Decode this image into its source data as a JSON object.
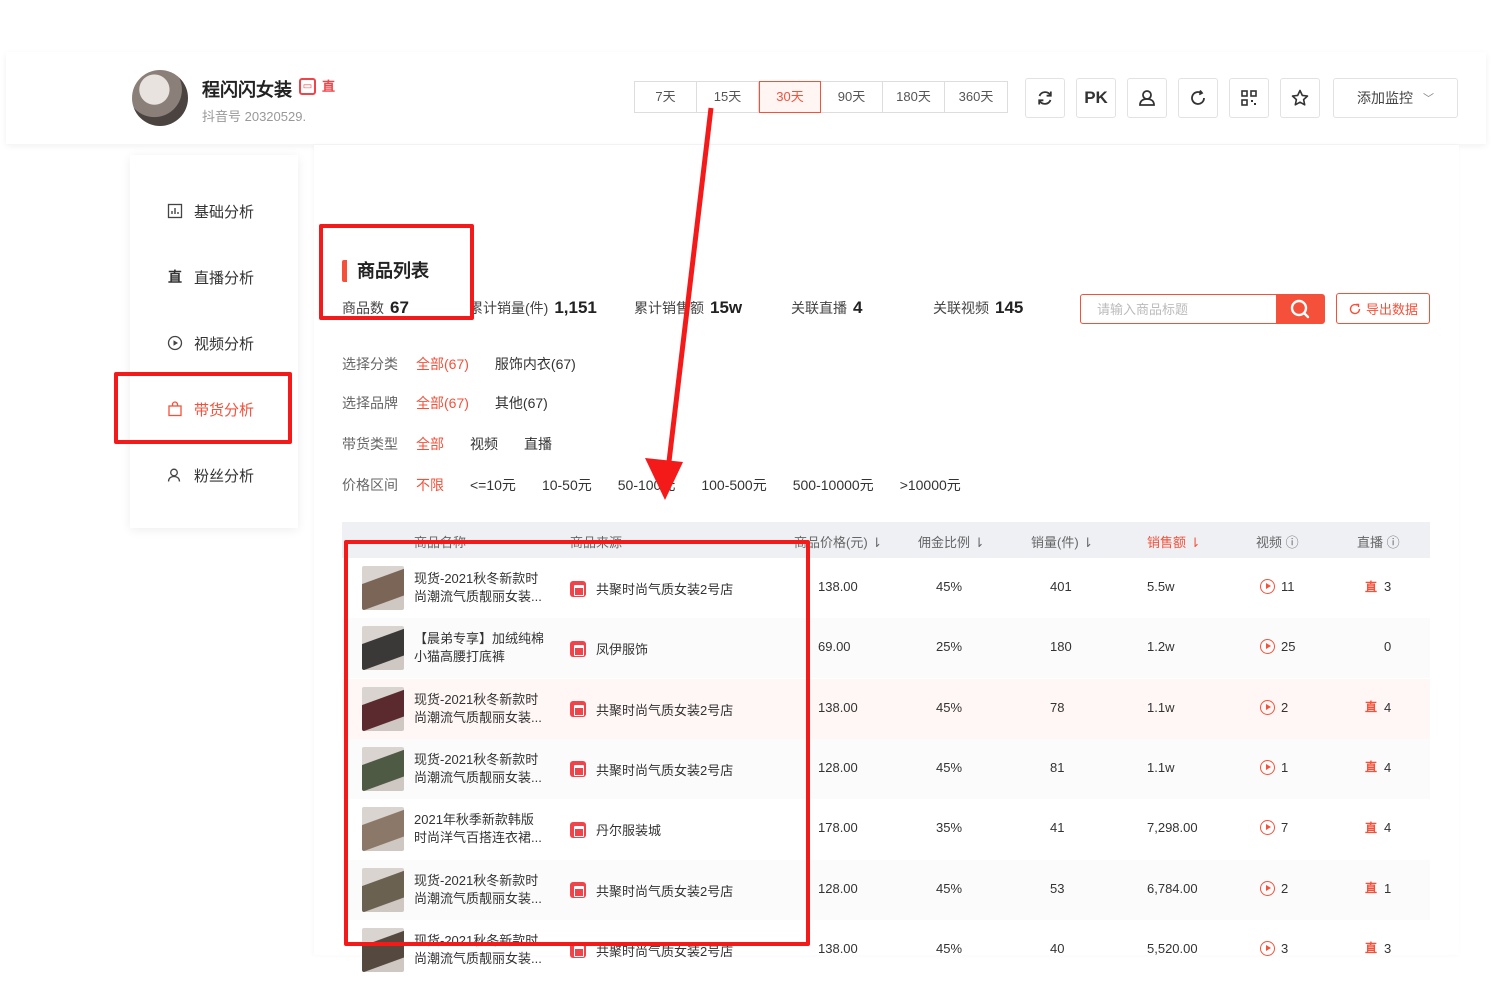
{
  "header": {
    "shop_name": "程闪闪女装",
    "douyin_id": "抖音号 20320529.",
    "badges": [
      "店",
      "直播"
    ],
    "periods": [
      "7天",
      "15天",
      "30天",
      "90天",
      "180天",
      "360天"
    ],
    "active_period": "30天",
    "tools": [
      "refresh-icon",
      "pk",
      "user-icon",
      "reload-icon",
      "qrcode-icon",
      "star-icon"
    ],
    "pk_label": "PK",
    "add_monitor_label": "添加监控"
  },
  "sidebar": {
    "items": [
      {
        "label": "基础分析",
        "icon": "bar-chart-icon"
      },
      {
        "label": "直播分析",
        "icon": "live-icon"
      },
      {
        "label": "视频分析",
        "icon": "play-circle-icon"
      },
      {
        "label": "带货分析",
        "icon": "bag-icon",
        "active": true
      },
      {
        "label": "粉丝分析",
        "icon": "user-icon"
      }
    ]
  },
  "main": {
    "title": "商品列表",
    "stats": [
      {
        "label": "商品数",
        "value": "67"
      },
      {
        "label": "累计销量(件)",
        "value": "1,151"
      },
      {
        "label": "累计销售额",
        "value": "15w"
      },
      {
        "label": "关联直播",
        "value": "4"
      },
      {
        "label": "关联视频",
        "value": "145"
      }
    ],
    "search_placeholder": "请输入商品标题",
    "export_label": "导出数据",
    "filters": [
      {
        "label": "选择分类",
        "options": [
          "全部(67)",
          "服饰内衣(67)"
        ],
        "active": 0
      },
      {
        "label": "选择品牌",
        "options": [
          "全部(67)",
          "其他(67)"
        ],
        "active": 0
      },
      {
        "label": "带货类型",
        "options": [
          "全部",
          "视频",
          "直播"
        ],
        "active": 0
      },
      {
        "label": "价格区间",
        "options": [
          "不限",
          "<=10元",
          "10-50元",
          "50-100元",
          "100-500元",
          "500-10000元",
          ">10000元"
        ],
        "active": 0
      }
    ],
    "table": {
      "headers": [
        "商品名称",
        "商品来源",
        "商品价格(元)",
        "佣金比例",
        "销量(件)",
        "销售额",
        "视频",
        "直播"
      ],
      "rows": [
        {
          "name1": "现货-2021秋冬新款时",
          "name2": "尚潮流气质靓丽女装...",
          "source": "共聚时尚气质女装2号店",
          "price": "138.00",
          "commission": "45%",
          "sales": "401",
          "revenue": "5.5w",
          "video": "11",
          "live": "3",
          "has_live": true,
          "thumb": "#7a6556"
        },
        {
          "name1": "【晨弟专享】加绒纯棉",
          "name2": "小猫高腰打底裤",
          "source": "凤伊服饰",
          "price": "69.00",
          "commission": "25%",
          "sales": "180",
          "revenue": "1.2w",
          "video": "25",
          "live": "0",
          "has_live": false,
          "thumb": "#3b3838"
        },
        {
          "name1": "现货-2021秋冬新款时",
          "name2": "尚潮流气质靓丽女装...",
          "source": "共聚时尚气质女装2号店",
          "price": "138.00",
          "commission": "45%",
          "sales": "78",
          "revenue": "1.1w",
          "video": "2",
          "live": "4",
          "has_live": true,
          "thumb": "#5a2a2e"
        },
        {
          "name1": "现货-2021秋冬新款时",
          "name2": "尚潮流气质靓丽女装...",
          "source": "共聚时尚气质女装2号店",
          "price": "128.00",
          "commission": "45%",
          "sales": "81",
          "revenue": "1.1w",
          "video": "1",
          "live": "4",
          "has_live": true,
          "thumb": "#4f5a45"
        },
        {
          "name1": "2021年秋季新款韩版",
          "name2": "时尚洋气百搭连衣裙...",
          "source": "丹尔服装城",
          "price": "178.00",
          "commission": "35%",
          "sales": "41",
          "revenue": "7,298.00",
          "video": "7",
          "live": "4",
          "has_live": true,
          "thumb": "#8c7868"
        },
        {
          "name1": "现货-2021秋冬新款时",
          "name2": "尚潮流气质靓丽女装...",
          "source": "共聚时尚气质女装2号店",
          "price": "128.00",
          "commission": "45%",
          "sales": "53",
          "revenue": "6,784.00",
          "video": "2",
          "live": "1",
          "has_live": true,
          "thumb": "#6b6150"
        },
        {
          "name1": "现货-2021秋冬新款时",
          "name2": "尚潮流气质靓丽女装...",
          "source": "共聚时尚气质女装2号店",
          "price": "138.00",
          "commission": "45%",
          "sales": "40",
          "revenue": "5,520.00",
          "video": "3",
          "live": "3",
          "has_live": true,
          "thumb": "#55483f"
        }
      ]
    }
  },
  "colors": {
    "accent": "#f5513a",
    "annotation": "#f51a1a"
  }
}
